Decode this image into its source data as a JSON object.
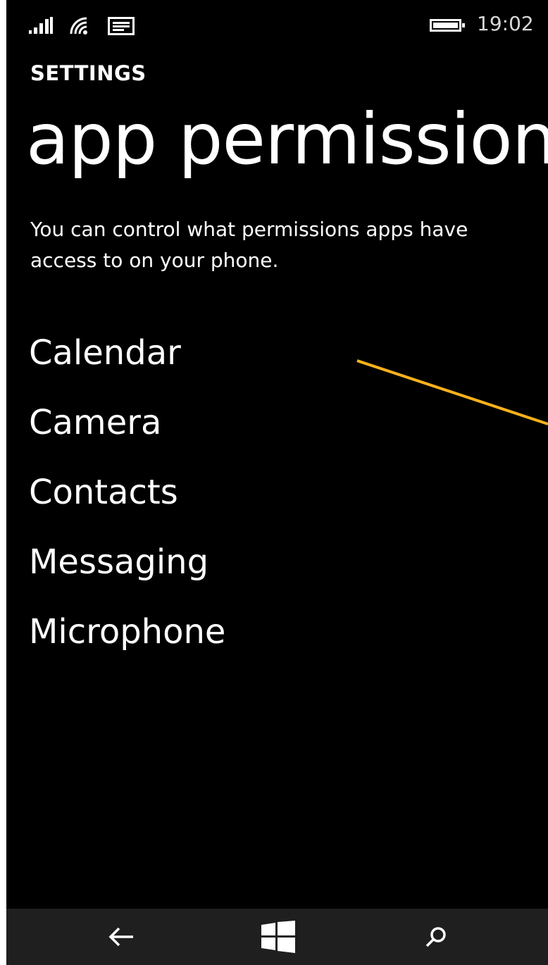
{
  "status_bar": {
    "time": "19:02",
    "signal_icon": "signal-bars-icon",
    "wifi_icon": "wifi-icon",
    "message_icon": "message-notification-icon",
    "battery_icon": "battery-icon"
  },
  "header": {
    "section_label": "SETTINGS",
    "title": "app permissions"
  },
  "description": "You can control what permissions apps have access to on your phone.",
  "permissions": [
    {
      "label": "Calendar"
    },
    {
      "label": "Camera"
    },
    {
      "label": "Contacts"
    },
    {
      "label": "Messaging"
    },
    {
      "label": "Microphone"
    }
  ],
  "annotation": {
    "color": "#f7b21c"
  },
  "nav_bar": {
    "back_icon": "back-arrow-icon",
    "start_icon": "windows-start-icon",
    "search_icon": "search-icon"
  },
  "colors": {
    "background": "#000000",
    "foreground": "#ffffff",
    "nav_background": "#1f1f1f"
  }
}
